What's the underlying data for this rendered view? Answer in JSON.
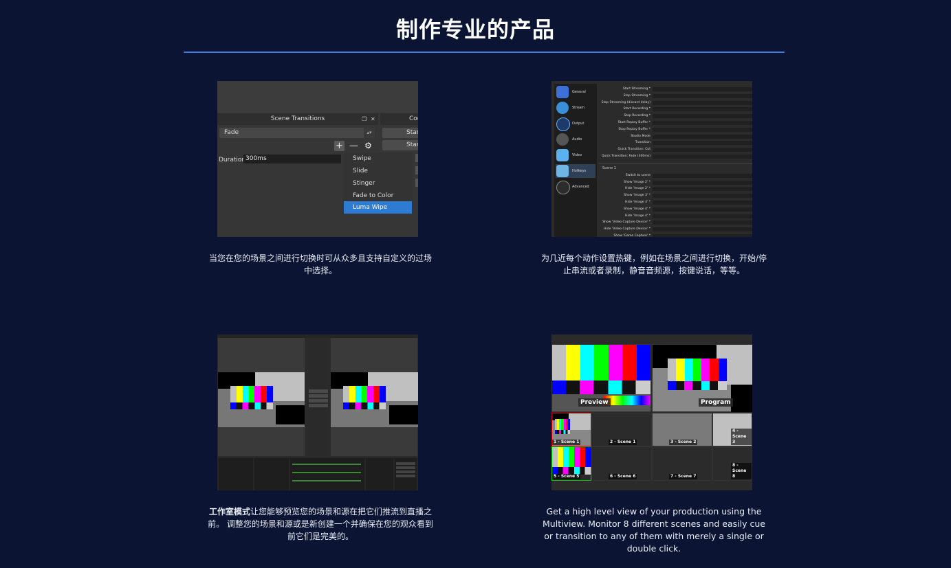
{
  "page": {
    "title": "制作专业的产品",
    "accent_color": "#3c7fe3",
    "background_color": "#0b1533"
  },
  "features": [
    {
      "caption": "当您在您的场景之间进行切换时可从众多且支持自定义的过场中选择。",
      "screenshot": {
        "dock_title": "Scene Transitions",
        "dock_title_cut": "Con",
        "selected_transition": "Fade",
        "side_button_1": "Star",
        "side_button_2": "Star",
        "duration_label": "Duration",
        "duration_value": "300ms",
        "menu_items": [
          "Swipe",
          "Slide",
          "Stinger",
          "Fade to Color",
          "Luma Wipe"
        ],
        "selected_menu_item": "Luma Wipe",
        "icons": [
          "plus-icon",
          "minus-icon",
          "gear-icon",
          "float-icon",
          "close-icon"
        ]
      }
    },
    {
      "caption": "为几近每个动作设置热键，例如在场景之间进行切换，开始/停止串流或者录制，静音音频源，按键说话，等等。",
      "screenshot": {
        "nav_items": [
          "General",
          "Stream",
          "Output",
          "Audio",
          "Video",
          "Hotkeys",
          "Advanced"
        ],
        "active_nav": "Hotkeys",
        "hotkey_rows": [
          "Start Streaming *",
          "Stop Streaming *",
          "Stop Streaming (discard delay)",
          "Start Recording *",
          "Stop Recording *",
          "Start Replay Buffer *",
          "Stop Replay Buffer *",
          "Studio Mode",
          "Transition",
          "Quick Transition: Cut",
          "Quick Transition: Fade (300ms)"
        ],
        "group_label": "Scene 1",
        "scene_rows": [
          "Switch to scene",
          "Show 'Image 2' *",
          "Hide 'Image 2' *",
          "Show 'Image 3' *",
          "Hide 'Image 3' *",
          "Show 'Image 4' *",
          "Hide 'Image 4' *",
          "Show 'Video Capture Device' *",
          "Hide 'Video Capture Device' *",
          "Show 'Game Capture' *"
        ]
      }
    },
    {
      "caption_bold": "工作室模式",
      "caption": "让您能够预览您的场景和源在把它们推流到直播之前。 调整您的场景和源或是新创建一个并确保在您的观众看到前它们是完美的。"
    },
    {
      "caption": "Get a high level view of your production using the Multiview. Monitor 8 different scenes and easily cue or transition to any of them with merely a single or double click.",
      "screenshot": {
        "preview_label": "Preview",
        "program_label": "Program",
        "scene_labels": [
          "1 - Scene 1",
          "2 - Scene 1",
          "3 - Scene 2",
          "4 - Scene 3",
          "5 - Scene 5",
          "6 - Scene 6",
          "7 - Scene 7",
          "8 - Scene 8"
        ]
      }
    }
  ],
  "colorbar_colors": [
    "#c0c0c0",
    "#ffff00",
    "#00ffff",
    "#00ff00",
    "#ff00ff",
    "#ff0000",
    "#0000ff"
  ]
}
